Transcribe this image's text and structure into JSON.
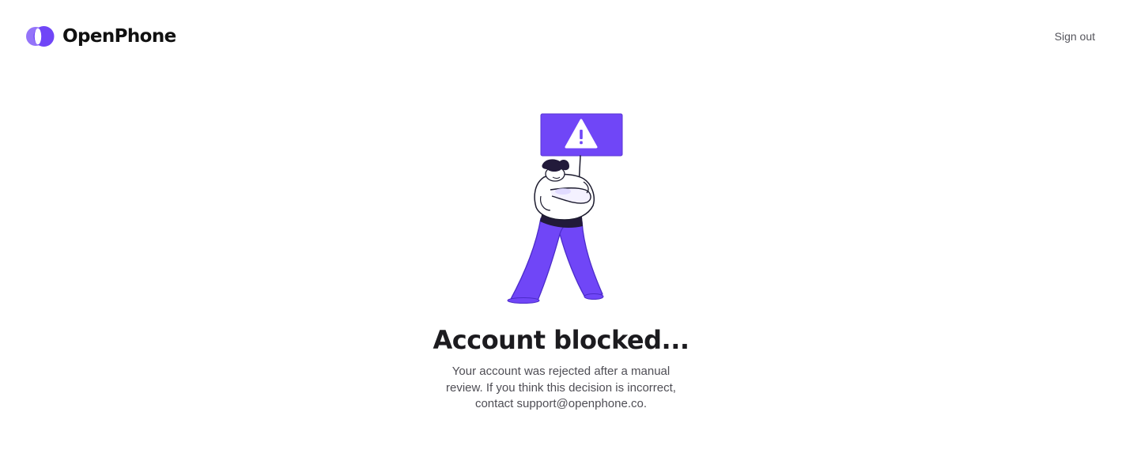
{
  "app": {
    "brand_name": "OpenPhone",
    "brand_color": "#7046f7"
  },
  "header": {
    "sign_out_label": "Sign out"
  },
  "blocked": {
    "title": "Account blocked...",
    "message": "Your account was rejected after a manual review. If you think this decision is incorrect, contact support@openphone.co.",
    "illustration": "person-holding-warning-sign",
    "sign_icon": "warning-triangle-icon"
  }
}
